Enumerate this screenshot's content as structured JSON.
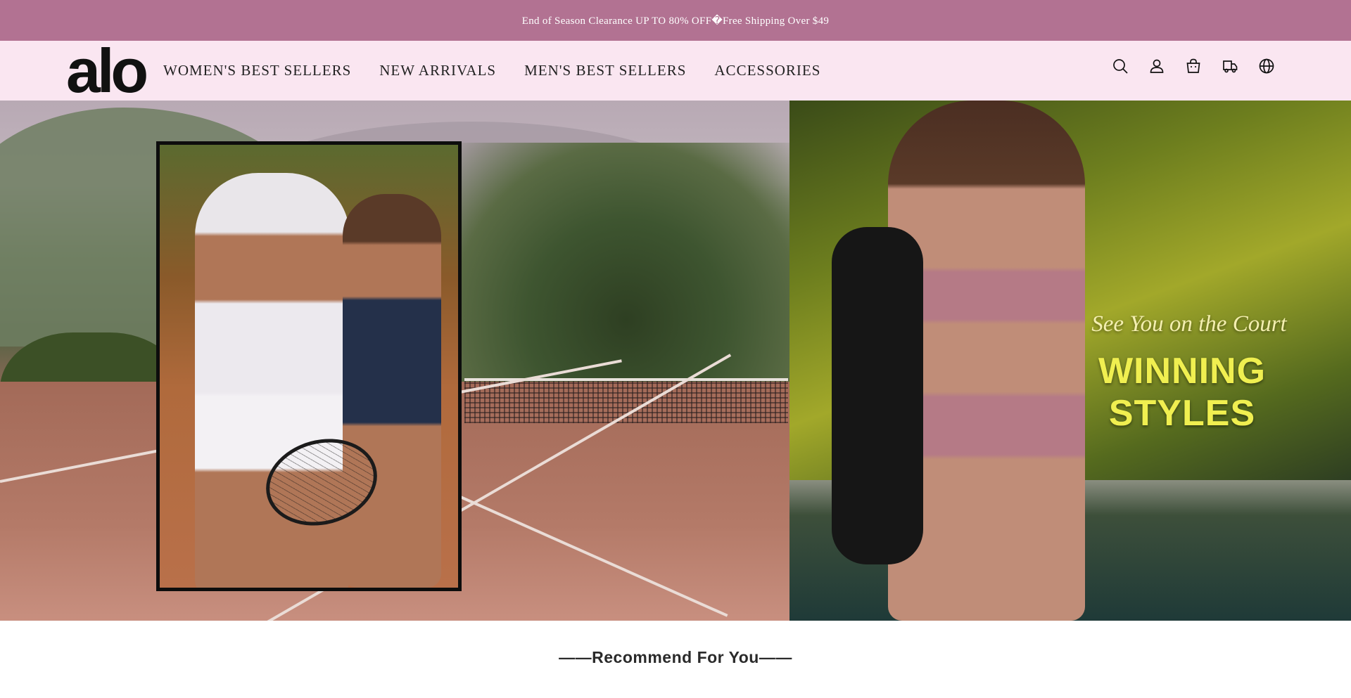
{
  "announcement": {
    "text": "End of Season Clearance UP TO 80% OFF�Free Shipping Over $49"
  },
  "header": {
    "logo_text": "alo",
    "nav": [
      {
        "label": "WOMEN'S BEST SELLERS"
      },
      {
        "label": "NEW ARRIVALS"
      },
      {
        "label": "MEN'S BEST SELLERS"
      },
      {
        "label": "ACCESSORIES"
      }
    ],
    "icons": [
      "search-icon",
      "account-icon",
      "cart-icon",
      "order-tracking-icon",
      "language-icon"
    ]
  },
  "hero": {
    "tagline": "See You on the Court",
    "headline": "WINNING STYLES"
  },
  "recommend": {
    "title": "——Recommend For You——"
  },
  "colors": {
    "announcement_bg": "#b27292",
    "header_bg": "#fae6f1",
    "headline_yellow": "#f0ef50"
  }
}
